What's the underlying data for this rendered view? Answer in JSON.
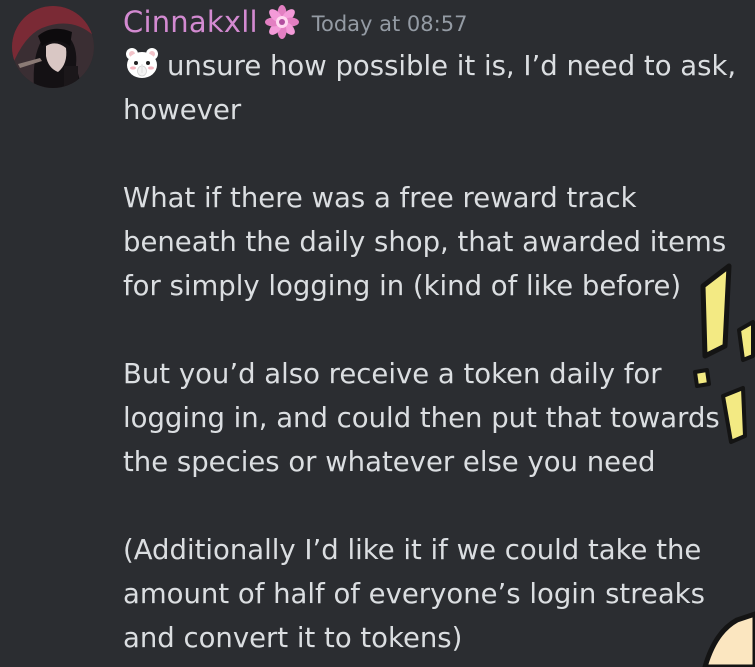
{
  "message": {
    "author": "Cinnakxll",
    "timestamp": "Today at 08:57",
    "emoji_icon": "bear-shh-emoji",
    "role_icon": "flower-badge-icon",
    "first_line": "unsure how possible it is, I’d need to ask, however",
    "paragraphs": [
      "What if there was a free reward track beneath the daily shop, that awarded items for simply logging in (kind of like before)",
      "But you’d also receive a token daily for logging in, and could then put that towards the species or whatever else you need",
      "(Additionally I’d like it if we could take the amount of half of everyone’s login streaks and convert it to tokens)"
    ]
  },
  "colors": {
    "background": "#2b2d31",
    "username": "#d38ad1",
    "text": "#dbdee1",
    "timestamp": "#949ba4",
    "decor_yellow": "#f3ea83"
  }
}
